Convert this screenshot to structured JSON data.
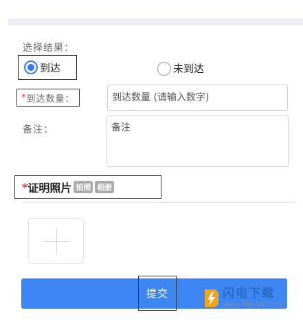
{
  "form": {
    "result_label": "选择结果：",
    "options": [
      {
        "label": "到达",
        "selected": true
      },
      {
        "label": "未到达",
        "selected": false
      }
    ],
    "quantity": {
      "required_mark": "*",
      "label": "到达数量：",
      "placeholder": "到达数量 (请输入数字)",
      "value": ""
    },
    "note": {
      "label": "备注：",
      "placeholder": "备注",
      "value": ""
    },
    "photo": {
      "required_mark": "*",
      "label": "证明照片",
      "tags": [
        "拍照",
        "相册"
      ]
    },
    "submit_label": "提交"
  },
  "watermark": {
    "title": "闪电下载",
    "url": "www.dianlut.com"
  },
  "colors": {
    "accent": "#3d86f2",
    "radio": "#2f7cf6",
    "required": "#e33333"
  }
}
